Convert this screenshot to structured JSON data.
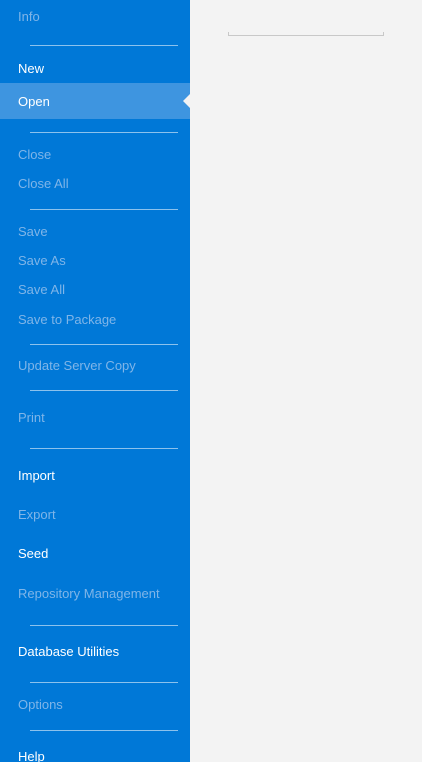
{
  "menu": {
    "info": "Info",
    "new": "New",
    "open": "Open",
    "close": "Close",
    "close_all": "Close All",
    "save": "Save",
    "save_as": "Save As",
    "save_all": "Save All",
    "save_to_package": "Save to Package",
    "update_server_copy": "Update Server Copy",
    "print": "Print",
    "import": "Import",
    "export": "Export",
    "seed": "Seed",
    "repository_management": "Repository Management",
    "database_utilities": "Database Utilities",
    "options": "Options",
    "help": "Help"
  },
  "colors": {
    "nav_background": "#0078d7",
    "selected_background": "#3e95e0",
    "disabled_text": "#7fb5e8",
    "enabled_text": "#ffffff",
    "content_background": "#f3f3f3"
  }
}
